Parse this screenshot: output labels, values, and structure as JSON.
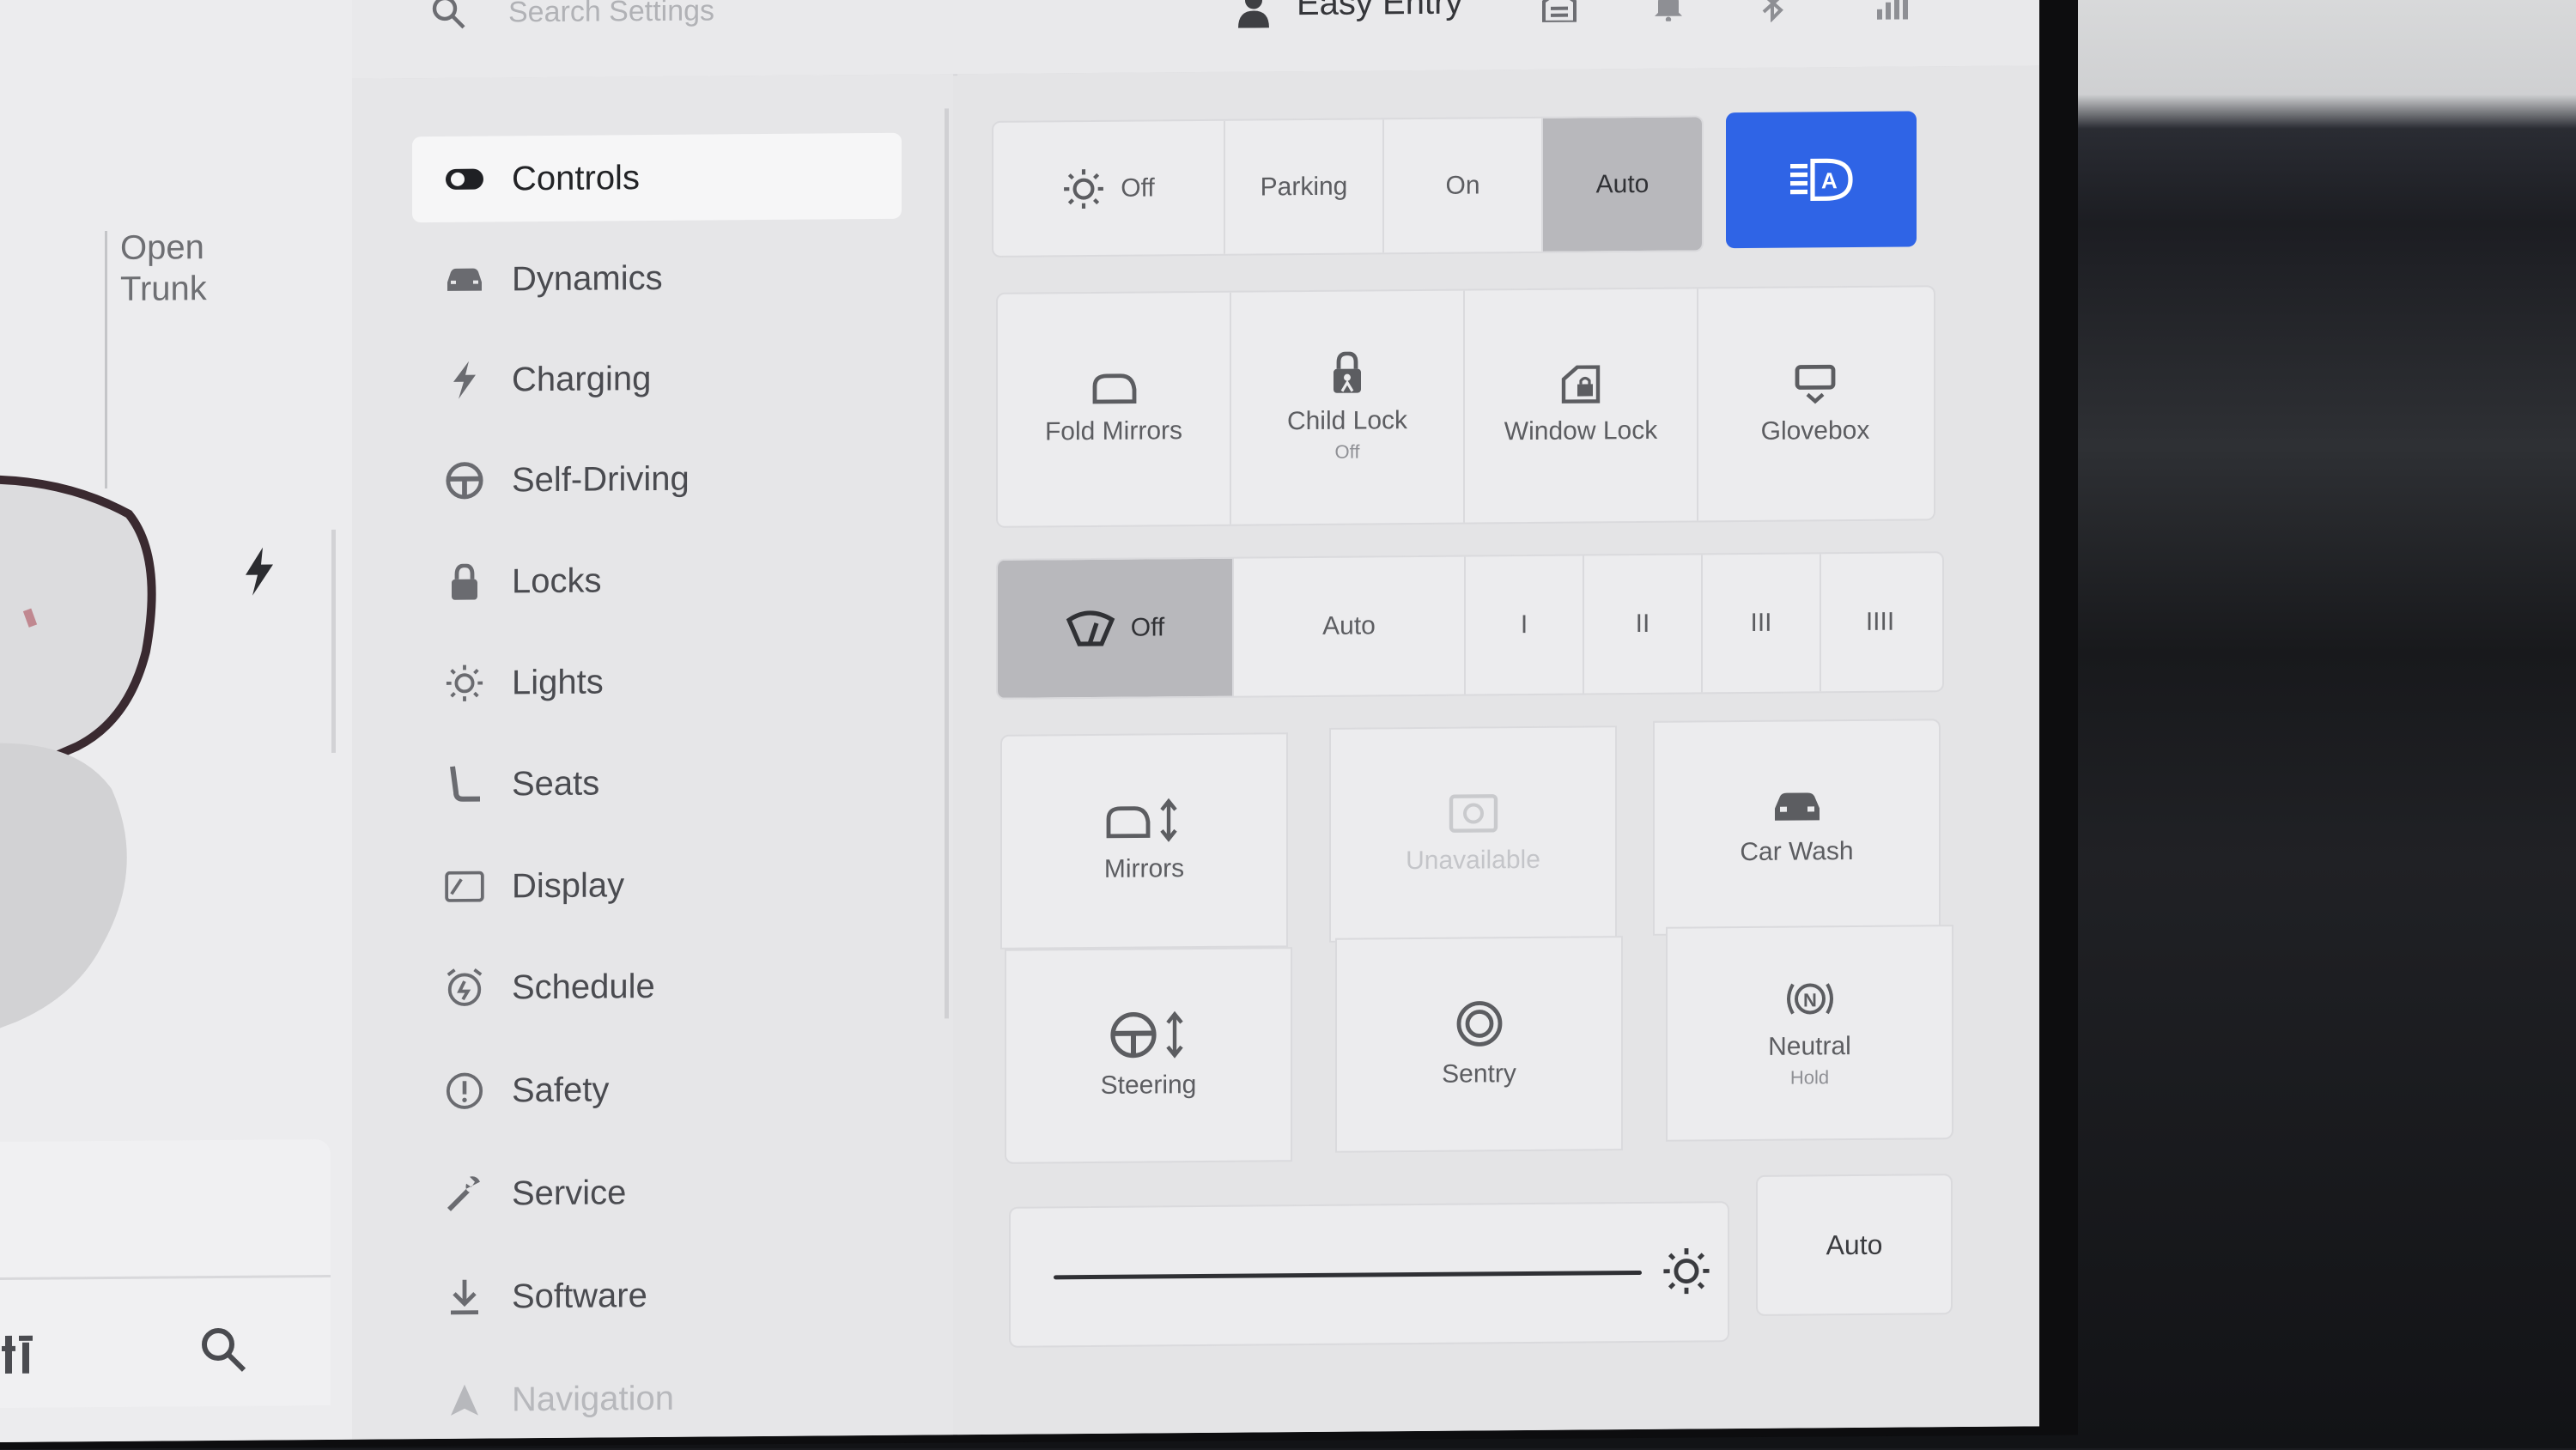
{
  "top_bar": {
    "search_placeholder": "Search Settings",
    "profile_name": "Easy Entry",
    "status_icons": [
      "garage-icon",
      "bell-icon",
      "bluetooth-icon",
      "lte-signal-icon"
    ]
  },
  "car_pane": {
    "trunk_label_line1": "Open",
    "trunk_label_line2": "Trunk"
  },
  "menu": {
    "items": [
      {
        "label": "Controls",
        "icon": "toggle-icon",
        "active": true
      },
      {
        "label": "Dynamics",
        "icon": "car-icon"
      },
      {
        "label": "Charging",
        "icon": "bolt-icon"
      },
      {
        "label": "Self-Driving",
        "icon": "steering-wheel-icon"
      },
      {
        "label": "Locks",
        "icon": "lock-icon"
      },
      {
        "label": "Lights",
        "icon": "sun-icon"
      },
      {
        "label": "Seats",
        "icon": "seat-icon"
      },
      {
        "label": "Display",
        "icon": "display-icon"
      },
      {
        "label": "Schedule",
        "icon": "alarm-clock-icon"
      },
      {
        "label": "Safety",
        "icon": "alert-circle-icon"
      },
      {
        "label": "Service",
        "icon": "wrench-icon"
      },
      {
        "label": "Software",
        "icon": "download-icon"
      },
      {
        "label": "Navigation",
        "icon": "navigation-arrow-icon"
      }
    ]
  },
  "controls": {
    "headlights": {
      "options": [
        "Off",
        "Parking",
        "On",
        "Auto"
      ],
      "selected": "Auto"
    },
    "auto_high_beam": {
      "icon": "auto-high-beam-icon",
      "enabled": true,
      "accent": "#2f64e6"
    },
    "quick_controls": [
      {
        "label": "Fold Mirrors",
        "sub": "",
        "icon": "mirror-icon"
      },
      {
        "label": "Child Lock",
        "sub": "Off",
        "icon": "child-lock-icon"
      },
      {
        "label": "Window Lock",
        "sub": "",
        "icon": "window-lock-icon"
      },
      {
        "label": "Glovebox",
        "sub": "",
        "icon": "glovebox-icon"
      }
    ],
    "wipers": {
      "options": [
        "Off",
        "Auto",
        "I",
        "II",
        "III",
        "IIII"
      ],
      "selected": "Off"
    },
    "tiles": [
      {
        "label": "Mirrors",
        "sub": "",
        "icon": "mirror-adjust-icon",
        "disabled": false
      },
      {
        "label": "Unavailable",
        "sub": "",
        "icon": "camera-box-icon",
        "disabled": true
      },
      {
        "label": "Car Wash",
        "sub": "",
        "icon": "car-wash-icon",
        "disabled": false
      },
      {
        "label": "Steering",
        "sub": "",
        "icon": "steering-adjust-icon",
        "disabled": false
      },
      {
        "label": "Sentry",
        "sub": "",
        "icon": "sentry-icon",
        "disabled": false
      },
      {
        "label": "Neutral",
        "sub": "Hold",
        "icon": "neutral-hold-icon",
        "disabled": false
      }
    ],
    "brightness": {
      "auto_label": "Auto",
      "level": 0.92
    }
  }
}
